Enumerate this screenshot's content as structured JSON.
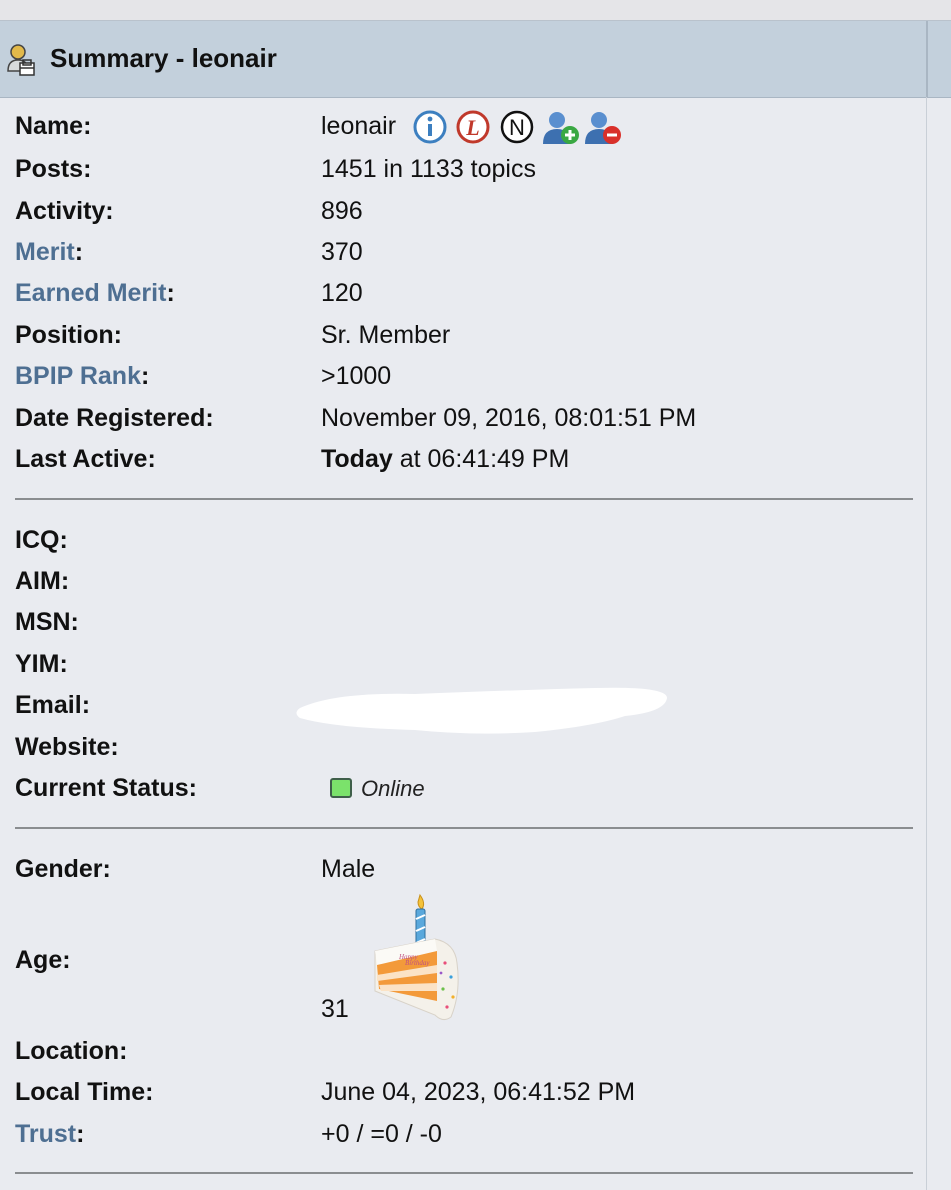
{
  "header": {
    "title": "Summary - leonair",
    "icon": "user-profile-icon"
  },
  "profile": {
    "name_label": "Name:",
    "name_value": "leonair",
    "name_icons": [
      "info-icon",
      "trust-l-icon",
      "ignore-n-icon",
      "add-buddy-icon",
      "remove-buddy-icon"
    ],
    "posts_label": "Posts:",
    "posts_value": "1451 in 1133 topics",
    "activity_label": "Activity:",
    "activity_value": "896",
    "merit_label": "Merit",
    "merit_value": "370",
    "earned_merit_label": "Earned Merit",
    "earned_merit_value": "120",
    "position_label": "Position:",
    "position_value": "Sr. Member",
    "bpip_label": "BPIP Rank",
    "bpip_value": ">1000",
    "registered_label": "Date Registered:",
    "registered_value": "November 09, 2016, 08:01:51 PM",
    "last_active_label": "Last Active:",
    "last_active_bold": "Today",
    "last_active_rest": " at 06:41:49 PM"
  },
  "contact": {
    "icq_label": "ICQ:",
    "aim_label": "AIM:",
    "msn_label": "MSN:",
    "yim_label": "YIM:",
    "email_label": "Email:",
    "website_label": "Website:",
    "status_label": "Current Status:",
    "status_value": "Online",
    "status_color": "#7be26b"
  },
  "personal": {
    "gender_label": "Gender:",
    "gender_value": "Male",
    "age_label": "Age:",
    "age_value": "31",
    "age_icon": "birthday-cake-icon",
    "location_label": "Location:",
    "local_time_label": "Local Time:",
    "local_time_value": "June 04, 2023, 06:41:52 PM",
    "trust_label": "Trust",
    "trust_value": "+0 / =0 / -0"
  },
  "colors": {
    "link": "#4e6f92",
    "header_bg": "#c3d0dc",
    "panel_bg": "#e9ebf0"
  },
  "colon": ":"
}
